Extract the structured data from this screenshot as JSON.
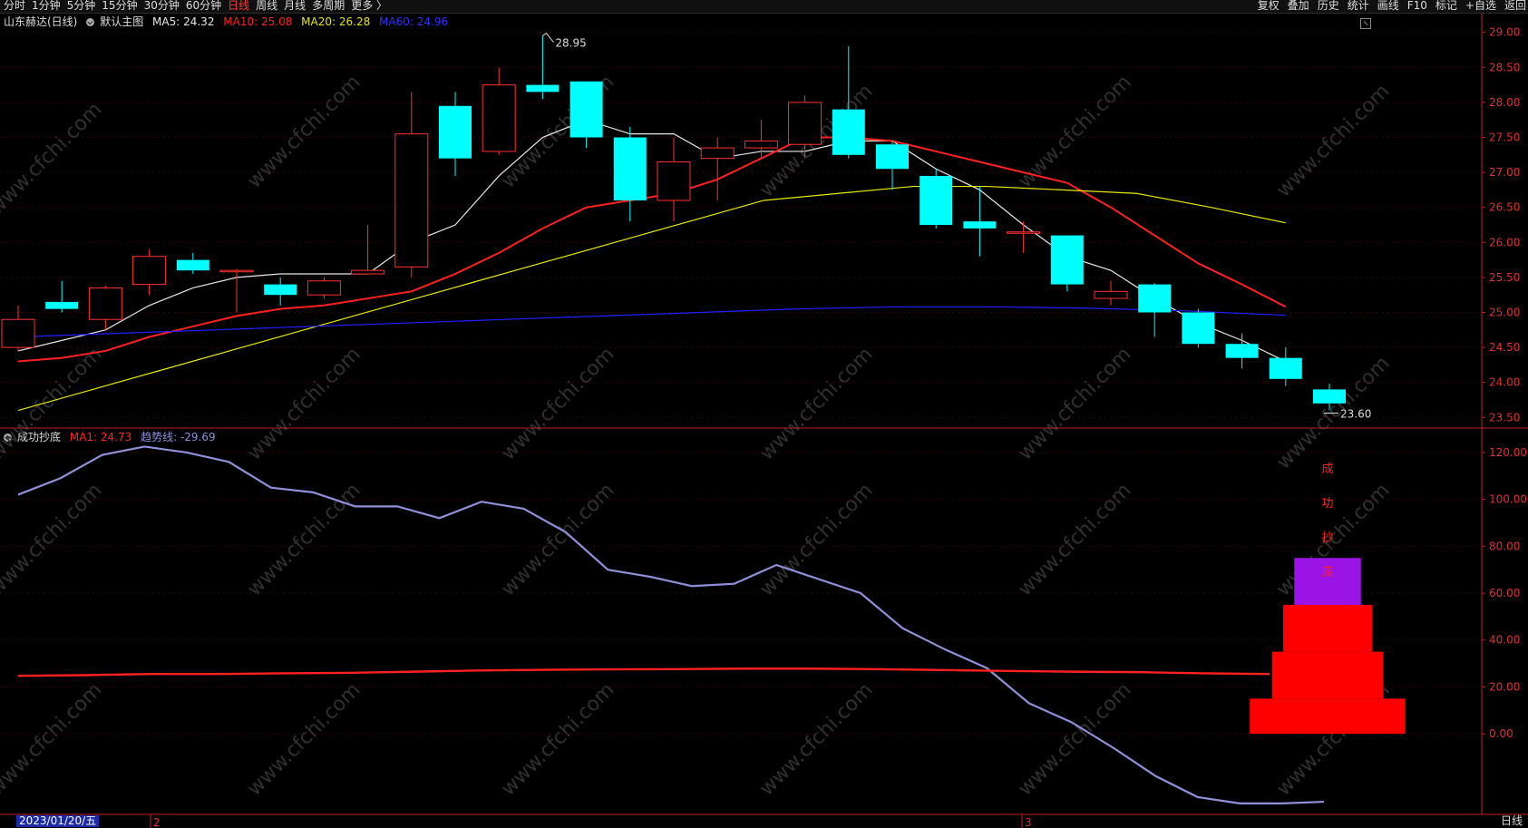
{
  "toolbar": {
    "left_items": [
      "分时",
      "1分钟",
      "5分钟",
      "15分钟",
      "30分钟",
      "60分钟",
      "日线",
      "周线",
      "月线",
      "多周期",
      "更多 〉"
    ],
    "active_item": "日线",
    "right_items": [
      "复权",
      "叠加",
      "历史",
      "统计",
      "画线",
      "F10",
      "标记",
      "+自选",
      "返回"
    ]
  },
  "main_header": {
    "stock": "山东赫达(日线)",
    "template": "默认主图",
    "ma5": "MA5: 24.32",
    "ma10": "MA10: 25.08",
    "ma20": "MA20: 26.28",
    "ma60": "MA60: 24.96",
    "colors": {
      "ma5": "#e8e8e8",
      "ma10": "#ff2020",
      "ma20": "#e6e600",
      "ma60": "#2020ff"
    }
  },
  "sub_header": {
    "name": "成功抄底",
    "ma1": "MA1: 24.73",
    "trend": "趋势线: -29.69",
    "colors": {
      "ma1": "#ff2020",
      "trend": "#9090d8"
    }
  },
  "footer": {
    "date": "2023/01/20/五",
    "month_marks": [
      "2",
      "3"
    ],
    "period": "日线"
  },
  "chart_data": [
    {
      "type": "candlestick",
      "title": "山东赫达(日线)",
      "ylim": [
        23.4,
        29.1
      ],
      "y_ticks": [
        "29.00",
        "28.50",
        "28.00",
        "27.50",
        "27.00",
        "26.50",
        "26.00",
        "25.50",
        "25.00",
        "24.50",
        "24.00",
        "23.50"
      ],
      "colors": {
        "up": "#ff3030",
        "down": "#00ffff"
      },
      "candles": [
        {
          "o": 24.5,
          "c": 24.9,
          "h": 25.1,
          "l": 24.45
        },
        {
          "o": 25.15,
          "c": 25.05,
          "h": 25.45,
          "l": 25.0
        },
        {
          "o": 24.9,
          "c": 25.35,
          "h": 25.38,
          "l": 24.75
        },
        {
          "o": 25.4,
          "c": 25.8,
          "h": 25.9,
          "l": 25.25
        },
        {
          "o": 25.75,
          "c": 25.6,
          "h": 25.85,
          "l": 25.55
        },
        {
          "o": 25.6,
          "c": 25.6,
          "h": 25.62,
          "l": 25.0
        },
        {
          "o": 25.4,
          "c": 25.25,
          "h": 25.5,
          "l": 25.1
        },
        {
          "o": 25.25,
          "c": 25.45,
          "h": 25.5,
          "l": 25.2
        },
        {
          "o": 25.55,
          "c": 25.6,
          "h": 26.25,
          "l": 25.55
        },
        {
          "o": 25.65,
          "c": 27.55,
          "h": 28.15,
          "l": 25.5
        },
        {
          "o": 27.95,
          "c": 27.2,
          "h": 28.15,
          "l": 26.95
        },
        {
          "o": 27.3,
          "c": 28.25,
          "h": 28.5,
          "l": 27.25
        },
        {
          "o": 28.25,
          "c": 28.15,
          "h": 28.95,
          "l": 28.05
        },
        {
          "o": 28.3,
          "c": 27.5,
          "h": 28.3,
          "l": 27.35
        },
        {
          "o": 27.5,
          "c": 26.6,
          "h": 27.65,
          "l": 26.3
        },
        {
          "o": 26.6,
          "c": 27.15,
          "h": 27.5,
          "l": 26.3
        },
        {
          "o": 27.2,
          "c": 27.35,
          "h": 27.5,
          "l": 26.6
        },
        {
          "o": 27.35,
          "c": 27.45,
          "h": 27.75,
          "l": 27.2
        },
        {
          "o": 27.4,
          "c": 28.0,
          "h": 28.1,
          "l": 27.2
        },
        {
          "o": 27.9,
          "c": 27.25,
          "h": 28.8,
          "l": 27.2
        },
        {
          "o": 27.4,
          "c": 27.05,
          "h": 27.45,
          "l": 26.75
        },
        {
          "o": 26.95,
          "c": 26.25,
          "h": 27.05,
          "l": 26.2
        },
        {
          "o": 26.3,
          "c": 26.2,
          "h": 26.8,
          "l": 25.8
        },
        {
          "o": 26.15,
          "c": 26.15,
          "h": 26.3,
          "l": 25.85
        },
        {
          "o": 26.1,
          "c": 25.4,
          "h": 26.1,
          "l": 25.3
        },
        {
          "o": 25.2,
          "c": 25.3,
          "h": 25.45,
          "l": 25.1
        },
        {
          "o": 25.4,
          "c": 25.0,
          "h": 25.42,
          "l": 24.65
        },
        {
          "o": 25.0,
          "c": 24.55,
          "h": 25.05,
          "l": 24.5
        },
        {
          "o": 24.55,
          "c": 24.35,
          "h": 24.7,
          "l": 24.2
        },
        {
          "o": 24.35,
          "c": 24.05,
          "h": 24.5,
          "l": 23.95
        },
        {
          "o": 23.9,
          "c": 23.7,
          "h": 23.98,
          "l": 23.6
        }
      ],
      "annotations": [
        {
          "text": "28.95",
          "index": 12,
          "value": 28.95
        },
        {
          "text": "23.60",
          "index": 30,
          "value": 23.6
        }
      ],
      "series": [
        {
          "name": "MA5",
          "color": "#e8e8e8",
          "values": [
            24.45,
            24.6,
            24.75,
            25.1,
            25.35,
            25.5,
            25.55,
            25.55,
            25.55,
            26.0,
            26.25,
            26.95,
            27.5,
            27.75,
            27.55,
            27.55,
            27.2,
            27.3,
            27.3,
            27.45,
            27.45,
            27.05,
            26.75,
            26.25,
            25.8,
            25.6,
            25.2,
            24.85,
            24.6,
            24.3
          ]
        },
        {
          "name": "MA10",
          "color": "#ff2020",
          "values": [
            24.3,
            24.35,
            24.45,
            24.65,
            24.8,
            24.95,
            25.05,
            25.1,
            25.2,
            25.3,
            25.55,
            25.85,
            26.2,
            26.5,
            26.6,
            26.7,
            26.9,
            27.2,
            27.5,
            27.5,
            27.45,
            27.3,
            27.15,
            27.0,
            26.85,
            26.5,
            26.1,
            25.7,
            25.4,
            25.08
          ]
        },
        {
          "name": "MA20",
          "color": "#e6e600",
          "values": [
            23.6,
            23.9,
            24.2,
            24.5,
            24.8,
            25.1,
            25.4,
            25.7,
            26.0,
            26.3,
            26.6,
            26.7,
            26.8,
            26.8,
            26.75,
            26.7,
            26.5,
            26.28
          ]
        },
        {
          "name": "MA60",
          "color": "#2020ff",
          "values": [
            24.65,
            24.7,
            24.75,
            24.8,
            24.85,
            24.9,
            24.95,
            25.0,
            25.05,
            25.08,
            25.08,
            25.06,
            25.02,
            24.96
          ]
        }
      ]
    },
    {
      "type": "line",
      "title": "成功抄底",
      "ylim": [
        -34,
        125
      ],
      "y_ticks": [
        "120.00",
        "100.00",
        "80.00",
        "60.00",
        "40.00",
        "20.00",
        "0.00"
      ],
      "series": [
        {
          "name": "趋势线",
          "color": "#9090d8",
          "values": [
            102,
            109,
            119,
            122.5,
            120,
            116,
            105,
            103,
            97,
            97,
            92,
            99,
            96,
            86,
            70,
            67,
            63,
            64,
            72,
            66,
            60,
            45,
            36,
            28,
            13,
            5,
            -6,
            -18,
            -27,
            -29.69,
            -29.69,
            -29
          ]
        },
        {
          "name": "MA1",
          "color": "#ff2020",
          "values": [
            24.73,
            25,
            25.5,
            25.5,
            25.8,
            26,
            26.5,
            27,
            27.3,
            27.5,
            27.6,
            27.8,
            27.8,
            27.6,
            27.2,
            26.8,
            26.5,
            26.3,
            25.8,
            25.5
          ]
        }
      ],
      "signal": {
        "text": "成功抄底",
        "levels": [
          {
            "value": 15,
            "width": 7
          },
          {
            "value": 35,
            "width": 5
          },
          {
            "value": 55,
            "width": 4
          },
          {
            "value": 75,
            "width": 3
          }
        ],
        "colors": {
          "bar": "#ff0000",
          "top": "#9b14e6",
          "text": "#ff2020"
        }
      }
    }
  ],
  "watermark": "www.cfchi.com"
}
